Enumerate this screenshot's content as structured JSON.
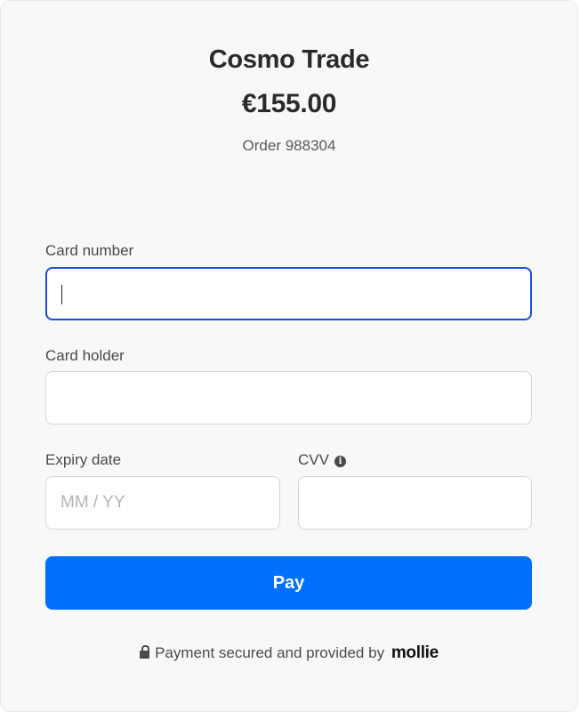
{
  "header": {
    "merchant_name": "Cosmo Trade",
    "amount": "€155.00",
    "order_label": "Order 988304"
  },
  "form": {
    "card_number": {
      "label": "Card number",
      "value": "",
      "placeholder": ""
    },
    "card_holder": {
      "label": "Card holder",
      "value": "",
      "placeholder": ""
    },
    "expiry": {
      "label": "Expiry date",
      "value": "",
      "placeholder": "MM / YY"
    },
    "cvv": {
      "label": "CVV",
      "value": "",
      "placeholder": "",
      "info_icon": "info-icon"
    },
    "pay_label": "Pay"
  },
  "footer": {
    "lock_icon": "lock-icon",
    "text": "Payment secured and provided by",
    "brand": "mollie"
  },
  "colors": {
    "accent": "#0070ff",
    "focus_border": "#1a4fd6",
    "panel_bg": "#f8f8f8"
  }
}
